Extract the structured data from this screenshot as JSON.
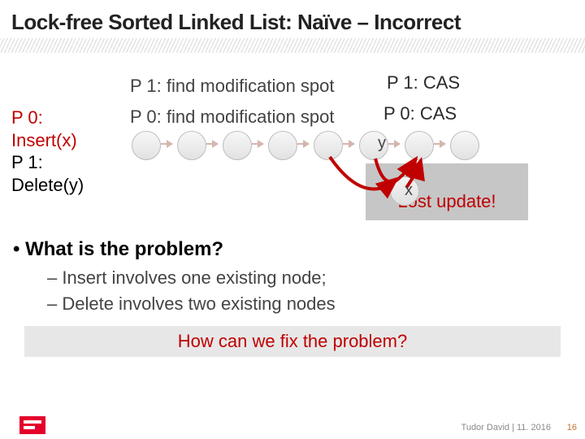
{
  "title": "Lock-free Sorted Linked List: Naïve – Incorrect",
  "ops": {
    "p0": {
      "label": "P 0:",
      "op": "Insert(x)"
    },
    "p1": {
      "label": "P 1:",
      "op": "Delete(y)"
    }
  },
  "annot": {
    "p1find": "P 1: find modification spot",
    "p1cas": "P 1: CAS",
    "p0find": "P 0: find modification spot",
    "p0cas": "P 0: CAS"
  },
  "labels": {
    "y": "y",
    "x": "x"
  },
  "lost_update": "Lost update!",
  "question": "• What is the problem?",
  "subs": {
    "a": "– Insert involves one existing node;",
    "b": "– Delete involves two existing nodes"
  },
  "fix_question": "How can we fix the problem?",
  "footer": {
    "credit": "Tudor David | 11. 2016",
    "page": "16"
  }
}
